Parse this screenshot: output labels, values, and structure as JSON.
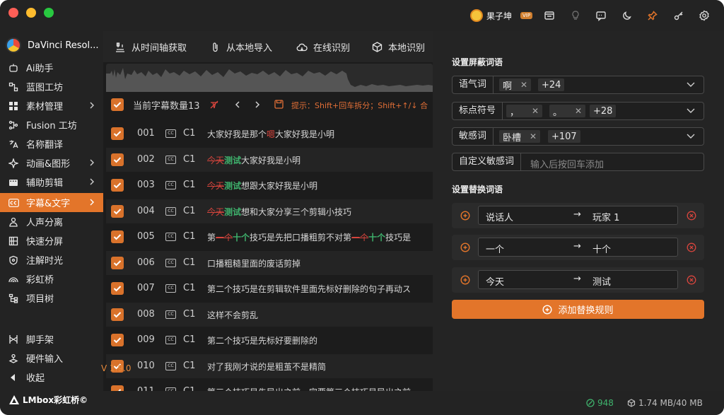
{
  "window": {
    "colors": {
      "accent": "#e3752a",
      "danger": "#d8453d",
      "success": "#3fb36d"
    }
  },
  "titlebar": {
    "user_name": "果子坤",
    "vip": "VIP",
    "icons": [
      "store-icon",
      "bulb-icon",
      "message-icon",
      "moon-icon",
      "pin-icon",
      "key-icon",
      "gear-icon"
    ]
  },
  "sidebar": {
    "app_name": "DaVinci Resol...",
    "items": [
      {
        "label": "Ai助手",
        "icon": "robot-icon"
      },
      {
        "label": "蓝图工坊",
        "icon": "blueprint-icon"
      },
      {
        "label": "素材管理",
        "icon": "grid-icon"
      },
      {
        "label": "Fusion 工坊",
        "icon": "fusion-icon"
      },
      {
        "label": "名称翻译",
        "icon": "translate-icon"
      },
      {
        "label": "动画&图形",
        "icon": "sparkle-icon"
      },
      {
        "label": "辅助剪辑",
        "icon": "film-icon"
      },
      {
        "label": "字幕&文字",
        "icon": "cc-icon"
      },
      {
        "label": "人声分离",
        "icon": "person-icon"
      },
      {
        "label": "快速分屏",
        "icon": "split-icon"
      },
      {
        "label": "注解时光",
        "icon": "shield-icon"
      },
      {
        "label": "彩虹桥",
        "icon": "rainbow-icon"
      },
      {
        "label": "项目树",
        "icon": "tree-icon"
      }
    ],
    "bottom_items": [
      {
        "label": "脚手架",
        "icon": "scaffold-icon"
      },
      {
        "label": "硬件输入",
        "icon": "joystick-icon"
      },
      {
        "label": "收起",
        "icon": "collapse-icon"
      }
    ],
    "brand": "LMbox彩虹桥©",
    "version": "V 1.9.0"
  },
  "toolbar": {
    "buttons": [
      "从时间轴获取",
      "从本地导入",
      "在线识别",
      "本地识别"
    ]
  },
  "subtitles": {
    "count_label": "当前字幕数量13",
    "hint": "提示：Shift+回车拆分；Shift+↑/↓ 合",
    "rows": [
      {
        "idx": "001",
        "ch": "C1",
        "parts": [
          [
            "n",
            "大家好我是那个"
          ],
          [
            "s",
            "嗯"
          ],
          [
            "n",
            "大家好我是小明"
          ]
        ]
      },
      {
        "idx": "002",
        "ch": "C1",
        "parts": [
          [
            "d",
            "今天"
          ],
          [
            "i",
            "测试"
          ],
          [
            "n",
            "大家好我是小明"
          ]
        ]
      },
      {
        "idx": "003",
        "ch": "C1",
        "parts": [
          [
            "d",
            "今天"
          ],
          [
            "i",
            "测试"
          ],
          [
            "n",
            "想跟大家好我是小明"
          ]
        ]
      },
      {
        "idx": "004",
        "ch": "C1",
        "parts": [
          [
            "d",
            "今天"
          ],
          [
            "i",
            "测试"
          ],
          [
            "n",
            "想和大家分享三个剪辑小技巧"
          ]
        ]
      },
      {
        "idx": "005",
        "ch": "C1",
        "parts": [
          [
            "n",
            "第"
          ],
          [
            "d",
            "一个"
          ],
          [
            "i",
            "十个"
          ],
          [
            "n",
            "技巧是先把口播粗剪不对第"
          ],
          [
            "d",
            "一个"
          ],
          [
            "i",
            "十个"
          ],
          [
            "n",
            "技巧是"
          ]
        ]
      },
      {
        "idx": "006",
        "ch": "C1",
        "parts": [
          [
            "n",
            "口播粗糙里面的废话剪掉"
          ]
        ]
      },
      {
        "idx": "007",
        "ch": "C1",
        "parts": [
          [
            "n",
            "第二个技巧是在剪辑软件里面先标好删除的句子再动ス"
          ]
        ]
      },
      {
        "idx": "008",
        "ch": "C1",
        "parts": [
          [
            "n",
            "这样不会剪乱"
          ]
        ]
      },
      {
        "idx": "009",
        "ch": "C1",
        "parts": [
          [
            "n",
            "第二个技巧是先标好要删除的"
          ]
        ]
      },
      {
        "idx": "010",
        "ch": "C1",
        "parts": [
          [
            "n",
            "对了我刚才说的是粗茧不是精简"
          ]
        ]
      },
      {
        "idx": "011",
        "ch": "C1",
        "parts": [
          [
            "n",
            "第三个技巧是先导出之前一定要第三个技巧是导出之前"
          ]
        ]
      }
    ]
  },
  "settings": {
    "mask_title": "设置屏蔽词语",
    "mask_fields": [
      {
        "label": "语气词",
        "tags": [
          "啊"
        ],
        "more": "+24"
      },
      {
        "label": "标点符号",
        "tags": [
          "，",
          "。"
        ],
        "more": "+28"
      },
      {
        "label": "敏感词",
        "tags": [
          "卧槽"
        ],
        "more": "+107"
      }
    ],
    "custom_label": "自定义敏感词",
    "custom_placeholder": "输入后按回车添加",
    "replace_title": "设置替换词语",
    "rules": [
      {
        "from": "说话人",
        "to": "玩家 1"
      },
      {
        "from": "一个",
        "to": "十个"
      },
      {
        "from": "今天",
        "to": "测试"
      }
    ],
    "add_rule_label": "添加替换规则"
  },
  "status": {
    "online": "948",
    "memory": "1.74 MB/40 MB"
  }
}
